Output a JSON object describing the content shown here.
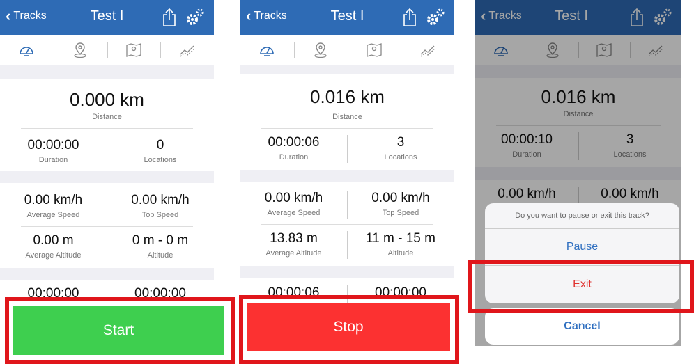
{
  "nav": {
    "back_label": "Tracks",
    "title": "Test I"
  },
  "tabs": [
    {
      "name": "speedometer-icon"
    },
    {
      "name": "map-pin-icon"
    },
    {
      "name": "map-icon"
    },
    {
      "name": "chart-icon"
    }
  ],
  "labels": {
    "distance": "Distance",
    "duration": "Duration",
    "locations": "Locations",
    "average_speed": "Average Speed",
    "top_speed": "Top Speed",
    "average_altitude": "Average Altitude",
    "altitude": "Altitude"
  },
  "screens": [
    {
      "distance": "0.000 km",
      "duration": "00:00:00",
      "locations": "0",
      "average_speed": "0.00 km/h",
      "top_speed": "0.00 km/h",
      "average_altitude": "0.00 m",
      "altitude_range": "0 m - 0 m",
      "time_left": "00:00:00",
      "time_right": "00:00:00",
      "action_label": "Start",
      "action_color": "#3ecf4f"
    },
    {
      "distance": "0.016 km",
      "duration": "00:00:06",
      "locations": "3",
      "average_speed": "0.00 km/h",
      "top_speed": "0.00 km/h",
      "average_altitude": "13.83 m",
      "altitude_range": "11 m - 15 m",
      "time_left": "00:00:06",
      "time_right": "00:00:00",
      "action_label": "Stop",
      "action_color": "#fc3131"
    },
    {
      "distance": "0.016 km",
      "duration": "00:00:10",
      "locations": "3",
      "average_speed": "0.00 km/h",
      "top_speed": "0.00 km/h"
    }
  ],
  "dialog": {
    "message": "Do you want to pause or exit this track?",
    "pause_label": "Pause",
    "exit_label": "Exit",
    "cancel_label": "Cancel"
  },
  "colors": {
    "nav_bg": "#2e6bb5",
    "highlight": "#e0161b",
    "pause_text": "#2f6fc0",
    "exit_text": "#e0312f"
  }
}
